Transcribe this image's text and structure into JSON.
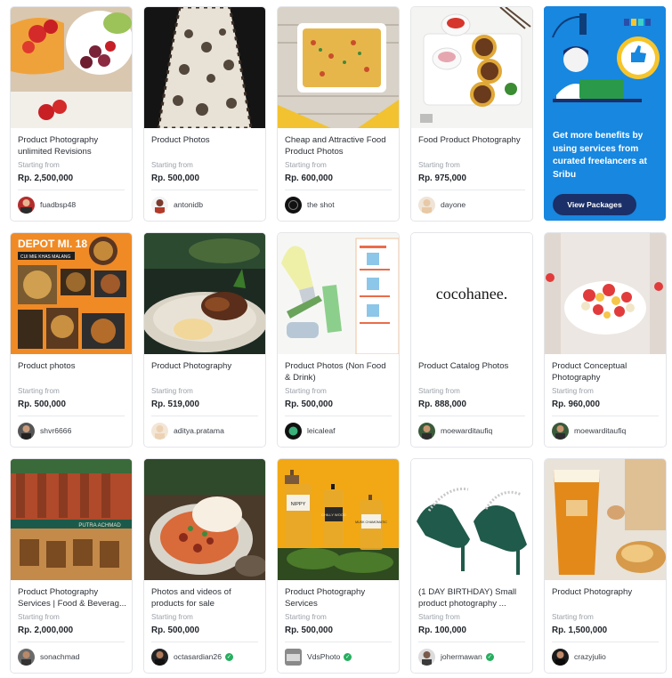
{
  "starting_from_label": "Starting from",
  "promo": {
    "text": "Get more benefits by using services from curated freelancers at Sribu",
    "button_label": "View Packages"
  },
  "services": [
    {
      "title": "Product Photography unlimited Revisions",
      "price": "Rp. 2,500,000",
      "seller": "fuadbsp48",
      "verified": false
    },
    {
      "title": "Product Photos",
      "price": "Rp. 500,000",
      "seller": "antonidb",
      "verified": false
    },
    {
      "title": "Cheap and Attractive Food Product Photos",
      "price": "Rp. 600,000",
      "seller": "the shot",
      "verified": false
    },
    {
      "title": "Food Product Photography",
      "price": "Rp. 975,000",
      "seller": "dayone",
      "verified": false
    },
    {
      "title": "Product photos",
      "price": "Rp. 500,000",
      "seller": "shvr6666",
      "verified": false
    },
    {
      "title": "Product Photography",
      "price": "Rp. 519,000",
      "seller": "aditya.pratama",
      "verified": false
    },
    {
      "title": "Product Photos (Non Food & Drink)",
      "price": "Rp. 500,000",
      "seller": "leicaleaf",
      "verified": false
    },
    {
      "title": "Product Catalog Photos",
      "price": "Rp. 888,000",
      "seller": "moewarditaufiq",
      "verified": false
    },
    {
      "title": "Product Conceptual Photography",
      "price": "Rp. 960,000",
      "seller": "moewarditaufiq",
      "verified": false
    },
    {
      "title": "Product Photography Services | Food & Beverag...",
      "price": "Rp. 2,000,000",
      "seller": "sonachmad",
      "verified": false
    },
    {
      "title": "Photos and videos of products for sale",
      "price": "Rp. 500,000",
      "seller": "octasardian26",
      "verified": true
    },
    {
      "title": "Product Photography Services",
      "price": "Rp. 500,000",
      "seller": "VdsPhoto",
      "verified": true
    },
    {
      "title": "(1 DAY BIRTHDAY) Small product photography ...",
      "price": "Rp. 100,000",
      "seller": "johermawan",
      "verified": true
    },
    {
      "title": "Product Photography",
      "price": "Rp. 1,500,000",
      "seller": "crazyjulio",
      "verified": false
    }
  ],
  "image_text": {
    "depot_banner": "DEPOT MI. 18",
    "depot_sub": "CUI MIE KHAS MALANG",
    "cocohanee_logo": "cocohanee.",
    "restaurant_sign": "PUTRA ACHMAD",
    "bottle_1": "NIPPY",
    "bottle_2": "CHILLY WOOD",
    "bottle_3": "MUSK CHAMOMATIC"
  }
}
